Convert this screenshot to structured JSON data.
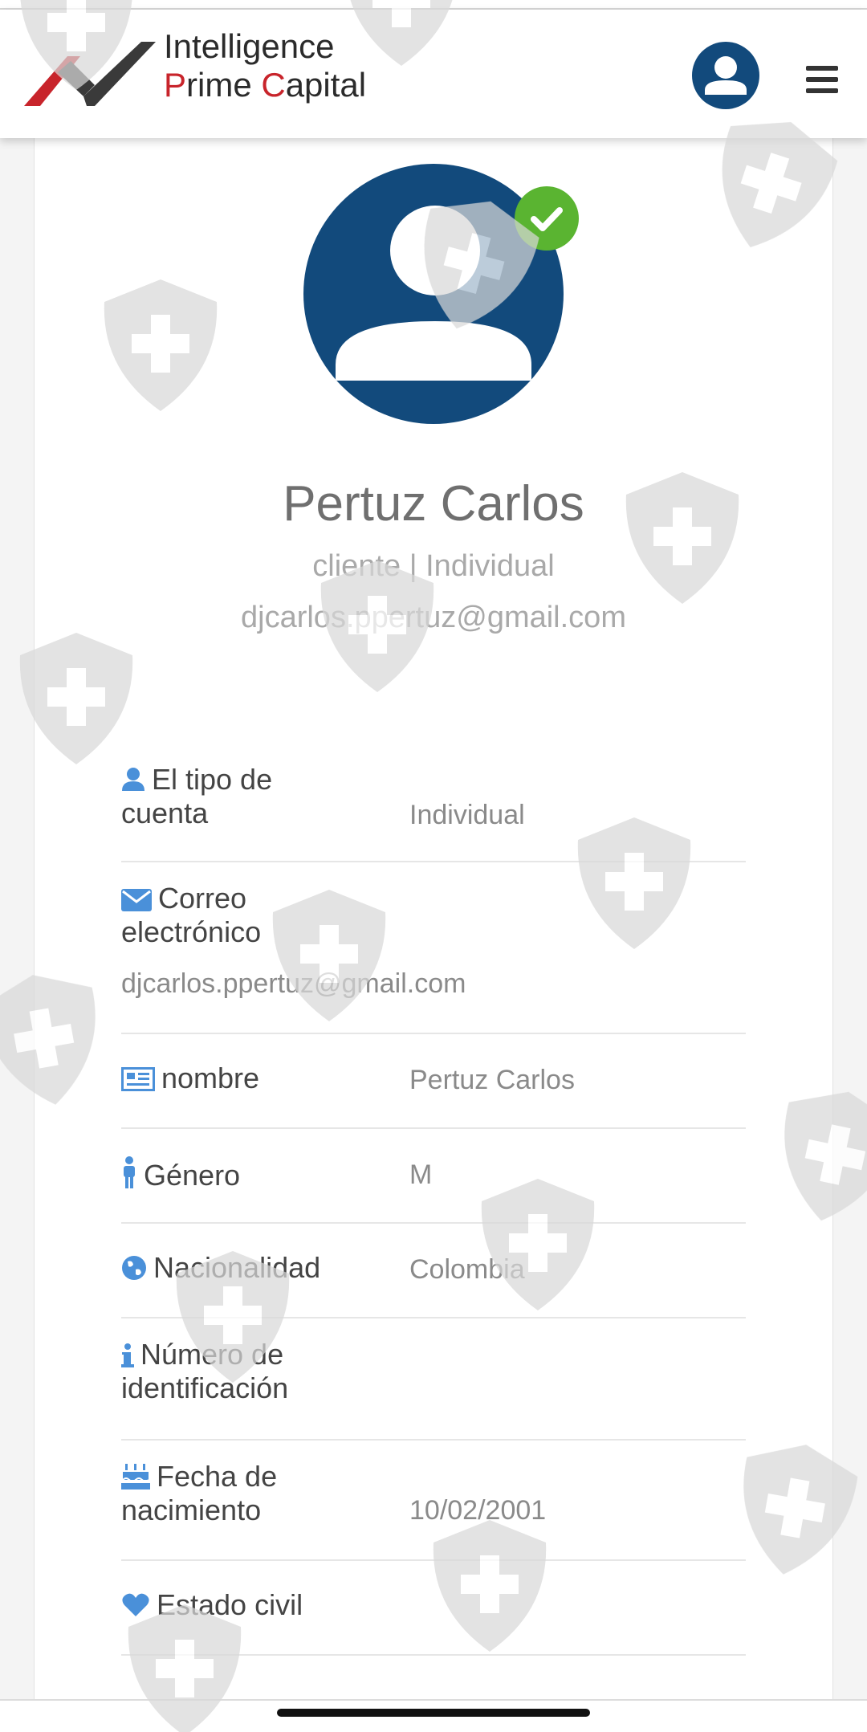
{
  "header": {
    "logo_line1": "Intelligence",
    "logo_line2_p": "P",
    "logo_line2_rest1": "rime ",
    "logo_line2_c": "C",
    "logo_line2_rest2": "apital",
    "icons": [
      "user-avatar-icon",
      "hamburger-menu-icon"
    ]
  },
  "profile": {
    "name": "Pertuz Carlos",
    "role_line": "cliente | Individual",
    "email": "djcarlos.ppertuz@gmail.com",
    "verified_icon": "check-badge-icon"
  },
  "details": [
    {
      "icon": "user-icon",
      "label_line1": "El tipo de",
      "label_line2": "cuenta",
      "value": "Individual"
    },
    {
      "icon": "envelope-icon",
      "label_line1": "Correo",
      "label_line2": "electrónico",
      "value": "djcarlos.ppertuz@gmail.com"
    },
    {
      "icon": "id-card-icon",
      "label_line1": "nombre",
      "label_line2": "",
      "value": "Pertuz Carlos"
    },
    {
      "icon": "male-icon",
      "label_line1": "Género",
      "label_line2": "",
      "value": "M"
    },
    {
      "icon": "globe-icon",
      "label_line1": "Nacionalidad",
      "label_line2": "",
      "value": "Colombia"
    },
    {
      "icon": "info-icon",
      "label_line1": "Número de",
      "label_line2": "identificación",
      "value": ""
    },
    {
      "icon": "birthday-cake-icon",
      "label_line1": "Fecha de",
      "label_line2": "nacimiento",
      "value": "10/02/2001"
    },
    {
      "icon": "heart-icon",
      "label_line1": "Estado civil",
      "label_line2": "",
      "value": ""
    }
  ],
  "colors": {
    "brand_blue": "#124a7c",
    "brand_red": "#c8242b",
    "icon_blue": "#4a90d9",
    "verified_green": "#5ab431"
  }
}
